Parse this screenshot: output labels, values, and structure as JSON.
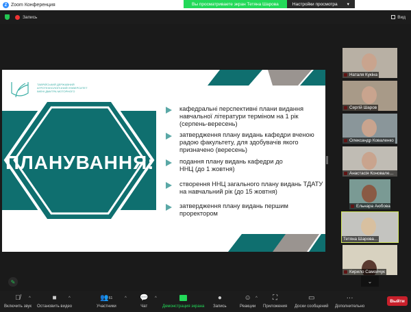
{
  "window": {
    "title": "Zoom Конференция",
    "icon": "zoom-logo-icon"
  },
  "share_banner": {
    "text": "Вы просматриваете экран Тетяна Шарова",
    "settings": "Настройки просмотра"
  },
  "top": {
    "record": "Запись",
    "view": "Вид"
  },
  "slide": {
    "logo_text": [
      "ТАВРІЙСЬКИЙ ДЕРЖАВНИЙ",
      "АГРОТЕХНОЛОГІЧНИЙ УНІВЕРСИТЕТ",
      "ІМЕНІ ДМИТРА МОТОРНОГО"
    ],
    "heading": "ПЛАНУВАННЯ:",
    "bullets": [
      "кафедральні перспективні плани видання навчальної літератури терміном на 1 рік (серпень-вересень)",
      "затвердження плану видань кафедри вченою радою факультету, для здобувачів якого призначено (вересень)",
      "подання плану видань кафедри до ННЦ (до 1 жовтня)",
      "створення ННЦ загального плану видань ТДАТУ на навчальний рік (до 15 жовтня)",
      "затвердження плану видань першим проректором"
    ],
    "colors": {
      "teal": "#0f6f6f",
      "gray": "#9a9490",
      "bullet": "#5aa8a6"
    }
  },
  "participants": [
    {
      "name": "Наталя Кукіна"
    },
    {
      "name": "Сергій Шаров"
    },
    {
      "name": "Олександр Коваленко"
    },
    {
      "name": "Анастасія Коноваленко"
    },
    {
      "name": "Ельнара Аюбова"
    },
    {
      "name": "Тетяна Шарова...",
      "active": true
    },
    {
      "name": "Кирило Самойчук"
    }
  ],
  "toolbar": {
    "unmute": "Включить звук",
    "video": "Остановить видео",
    "participants": "Участники",
    "participants_count": "61",
    "chat": "Чат",
    "share": "Демонстрация экрана",
    "record": "Запись",
    "reactions": "Реакции",
    "apps": "Приложения",
    "whiteboards": "Доски сообщений",
    "more": "Дополнительно",
    "leave": "Выйти"
  }
}
